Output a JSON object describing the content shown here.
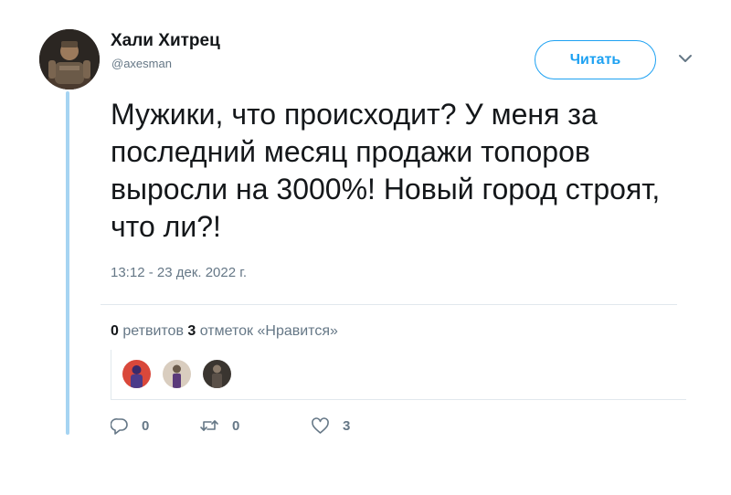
{
  "author": {
    "display_name": "Хали Хитрец",
    "handle": "@axesman"
  },
  "follow_button": {
    "label": "Читать"
  },
  "tweet": {
    "text": "Мужики, что происходит? У меня за последний месяц продажи топоров выросли на 3000%! Новый город строят, что ли?!",
    "timestamp": "13:12 - 23 дек. 2022 г."
  },
  "stats": {
    "retweets_count": "0",
    "retweets_label": "ретвитов",
    "likes_count": "3",
    "likes_label": "отметок «Нравится»"
  },
  "actions": {
    "reply_count": "0",
    "retweet_count": "0",
    "like_count": "3"
  },
  "colors": {
    "accent": "#1da1f2",
    "thread_line": "#a6d4f2",
    "muted_text": "#657786",
    "divider": "#e1e8ed"
  }
}
